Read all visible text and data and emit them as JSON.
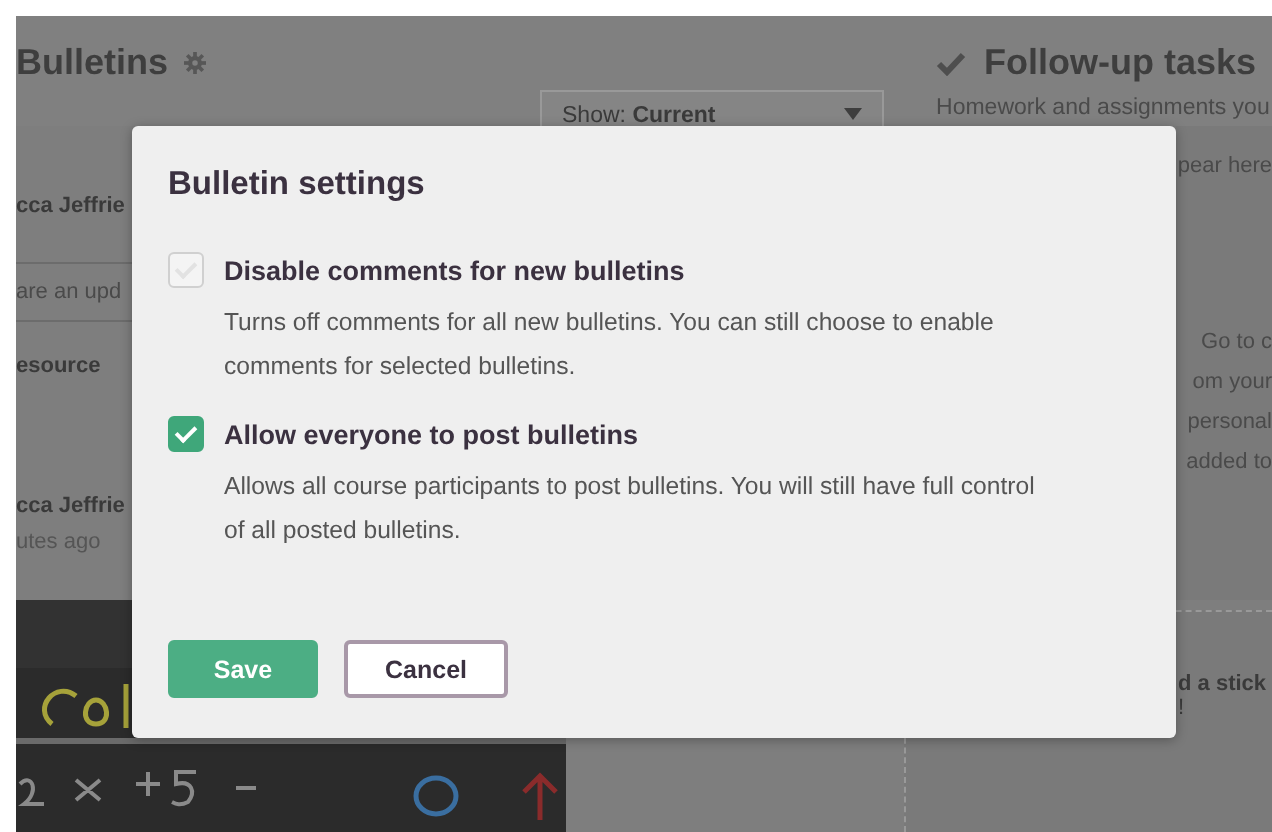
{
  "page": {
    "title": "Bulletins",
    "filter": {
      "label": "Show:",
      "value": "Current"
    },
    "feed_fragments": [
      {
        "kind": "name",
        "text": "cca Jeffrie"
      },
      {
        "kind": "input",
        "placeholder": "are an upd"
      },
      {
        "kind": "link",
        "text": "esource"
      },
      {
        "kind": "name",
        "text": "cca Jeffrie"
      },
      {
        "kind": "time",
        "text": "utes ago"
      }
    ]
  },
  "sidebar": {
    "title": "Follow-up tasks",
    "intro": "Homework and assignments you",
    "fragments": [
      "pear here",
      "Go to c",
      "om your",
      "personal",
      "added to"
    ],
    "sticky_fragments": [
      "d a stick",
      "!"
    ]
  },
  "dialog": {
    "title": "Bulletin settings",
    "options": [
      {
        "label": "Disable comments for new bulletins",
        "description": "Turns off comments for all new bulletins. You can still choose to enable comments for selected bulletins.",
        "checked": false
      },
      {
        "label": "Allow everyone to post bulletins",
        "description": "Allows all course participants to post bulletins. You will still have full control of all posted bulletins.",
        "checked": true
      }
    ],
    "buttons": [
      {
        "label": "Save",
        "kind": "primary"
      },
      {
        "label": "Cancel",
        "kind": "secondary"
      }
    ]
  }
}
